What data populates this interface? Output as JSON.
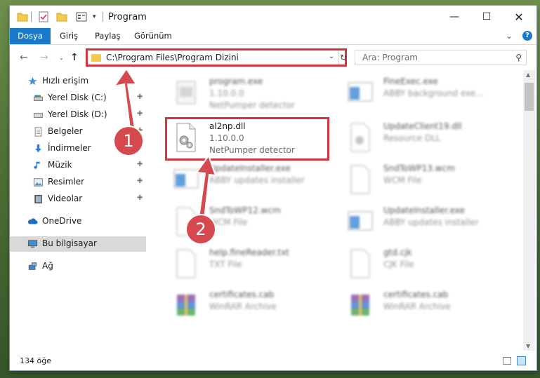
{
  "window": {
    "title": "Program",
    "buttons": {
      "minimize": "—",
      "maximize": "☐",
      "close": "✕"
    }
  },
  "ribbon": {
    "tabs": [
      "Dosya",
      "Giriş",
      "Paylaş",
      "Görünüm"
    ],
    "expand": "⌄",
    "help": "?"
  },
  "nav": {
    "back": "←",
    "forward": "→",
    "recent": "⌄",
    "up": "↑",
    "address": "C:\\Program Files\\Program Dizini",
    "address_dropdown": "⌄",
    "refresh": "↻",
    "search_placeholder": "Ara: Program",
    "search_icon": "⚲"
  },
  "sidebar": {
    "items": [
      {
        "label": "Hızlı erişim",
        "icon": "star-icon",
        "pinned": false
      },
      {
        "label": "Yerel Disk (C:)",
        "icon": "drive-icon",
        "pinned": true
      },
      {
        "label": "Yerel Disk (D:)",
        "icon": "drive-icon",
        "pinned": true
      },
      {
        "label": "Belgeler",
        "icon": "document-icon",
        "pinned": true
      },
      {
        "label": "İndirmeler",
        "icon": "download-icon",
        "pinned": true
      },
      {
        "label": "Müzik",
        "icon": "music-icon",
        "pinned": true
      },
      {
        "label": "Resimler",
        "icon": "pictures-icon",
        "pinned": true
      },
      {
        "label": "Videolar",
        "icon": "video-icon",
        "pinned": true
      },
      {
        "label": "OneDrive",
        "icon": "cloud-icon",
        "pinned": false
      },
      {
        "label": "Bu bilgisayar",
        "icon": "computer-icon",
        "pinned": false,
        "selected": true
      },
      {
        "label": "Ağ",
        "icon": "network-icon",
        "pinned": false
      }
    ],
    "pin_glyph": "📌"
  },
  "files": [
    {
      "name": "program.exe",
      "line2": "1.10.0.0",
      "line3": "NetPumper detector",
      "icon": "exe-icon",
      "blurred": true
    },
    {
      "name": "FineExec.exe",
      "line2": "ABBY background exe...",
      "line3": "",
      "icon": "app-icon",
      "blurred": true
    },
    {
      "name": "al2np.dll",
      "line2": "1.10.0.0",
      "line3": "NetPumper detector",
      "icon": "dll-icon",
      "blurred": false
    },
    {
      "name": "UpdateClient19.dll",
      "line2": "Resource DLL",
      "line3": "",
      "icon": "dll-icon",
      "blurred": true
    },
    {
      "name": "UpdateInstaller.exe",
      "line2": "ABBY updates installer",
      "line3": "",
      "icon": "app-icon",
      "blurred": true
    },
    {
      "name": "SndToWP13.wcm",
      "line2": "WCM File",
      "line3": "",
      "icon": "file-icon",
      "blurred": true
    },
    {
      "name": "SndToWP12.wcm",
      "line2": "WCM File",
      "line3": "",
      "icon": "file-icon",
      "blurred": true
    },
    {
      "name": "UpdateInstaller.exe",
      "line2": "ABBY updates installer",
      "line3": "",
      "icon": "app-icon",
      "blurred": true
    },
    {
      "name": "help.fineReader.txt",
      "line2": "TXT File",
      "line3": "",
      "icon": "file-icon",
      "blurred": true
    },
    {
      "name": "gtd.cjk",
      "line2": "CJK File",
      "line3": "",
      "icon": "file-icon",
      "blurred": true
    },
    {
      "name": "certificates.cab",
      "line2": "WinRAR Archive",
      "line3": "",
      "icon": "archive-icon",
      "blurred": true
    },
    {
      "name": "certificates.cab",
      "line2": "WinRAR Archive",
      "line3": "",
      "icon": "archive-icon",
      "blurred": true
    }
  ],
  "status": {
    "item_count": "134 öğe"
  },
  "annotations": {
    "step1": "1",
    "step2": "2"
  },
  "colors": {
    "accent": "#1979ca",
    "highlight": "#d2353e",
    "badge": "#d64a4f"
  }
}
